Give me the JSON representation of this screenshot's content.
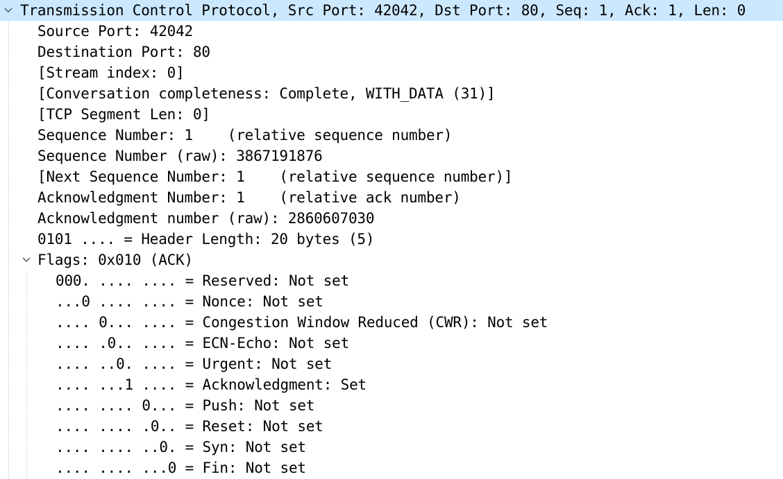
{
  "header_row": {
    "label": "Transmission Control Protocol, Src Port: 42042, Dst Port: 80, Seq: 1, Ack: 1, Len: 0",
    "expanded": true
  },
  "fields": [
    "Source Port: 42042",
    "Destination Port: 80",
    "[Stream index: 0]",
    "[Conversation completeness: Complete, WITH_DATA (31)]",
    "[TCP Segment Len: 0]",
    "Sequence Number: 1    (relative sequence number)",
    "Sequence Number (raw): 3867191876",
    "[Next Sequence Number: 1    (relative sequence number)]",
    "Acknowledgment Number: 1    (relative ack number)",
    "Acknowledgment number (raw): 2860607030",
    "0101 .... = Header Length: 20 bytes (5)"
  ],
  "flags_row": {
    "label": "Flags: 0x010 (ACK)",
    "expanded": true
  },
  "flag_fields": [
    "000. .... .... = Reserved: Not set",
    "...0 .... .... = Nonce: Not set",
    ".... 0... .... = Congestion Window Reduced (CWR): Not set",
    ".... .0.. .... = ECN-Echo: Not set",
    ".... ..0. .... = Urgent: Not set",
    ".... ...1 .... = Acknowledgment: Set",
    ".... .... 0... = Push: Not set",
    ".... .... .0.. = Reset: Not set",
    ".... .... ..0. = Syn: Not set",
    ".... .... ...0 = Fin: Not set"
  ],
  "icons": {
    "expand": "chevron-down-icon"
  },
  "colors": {
    "selection": "#cce8ff",
    "text": "#000000",
    "chevron": "#555555"
  }
}
